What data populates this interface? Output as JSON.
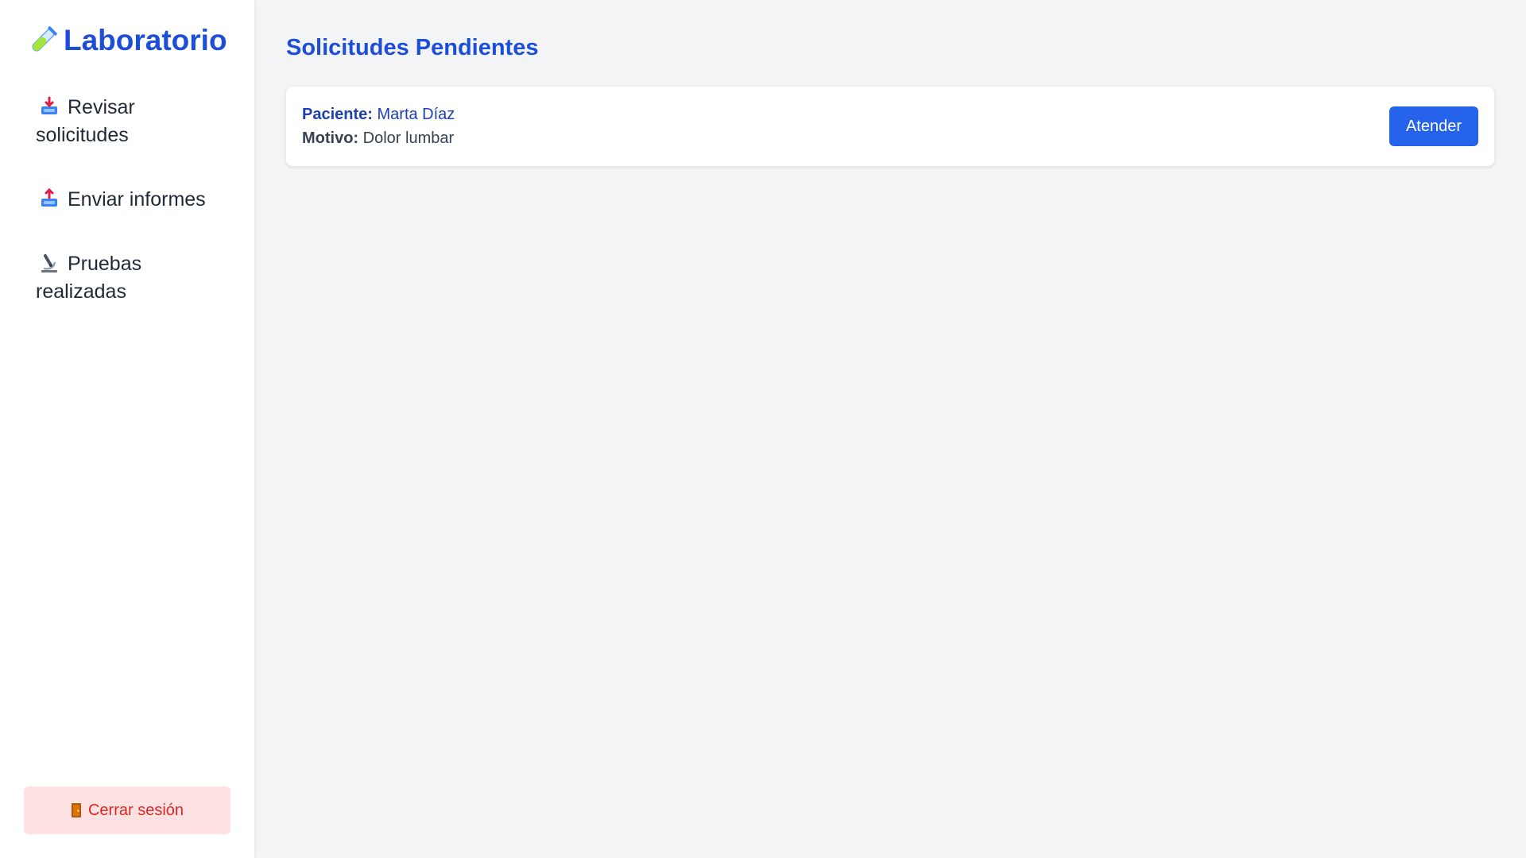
{
  "sidebar": {
    "brand": {
      "icon": "test-tube-icon",
      "title": "Laboratorio"
    },
    "items": [
      {
        "icon": "inbox-tray-icon",
        "label": "Revisar solicitudes"
      },
      {
        "icon": "outbox-tray-icon",
        "label": "Enviar informes"
      },
      {
        "icon": "microscope-icon",
        "label": "Pruebas realizadas"
      }
    ],
    "logout": {
      "icon": "door-icon",
      "label": "Cerrar sesión"
    }
  },
  "main": {
    "title": "Solicitudes Pendientes",
    "requests": [
      {
        "patient_label": "Paciente:",
        "patient_name": "Marta Díaz",
        "reason_label": "Motivo:",
        "reason": "Dolor lumbar",
        "action_label": "Atender"
      }
    ]
  },
  "colors": {
    "accent": "#1d4ed8",
    "button": "#2563eb",
    "background": "#f3f4f6",
    "logout_bg": "#fee2e2",
    "logout_text": "#dc2626"
  }
}
